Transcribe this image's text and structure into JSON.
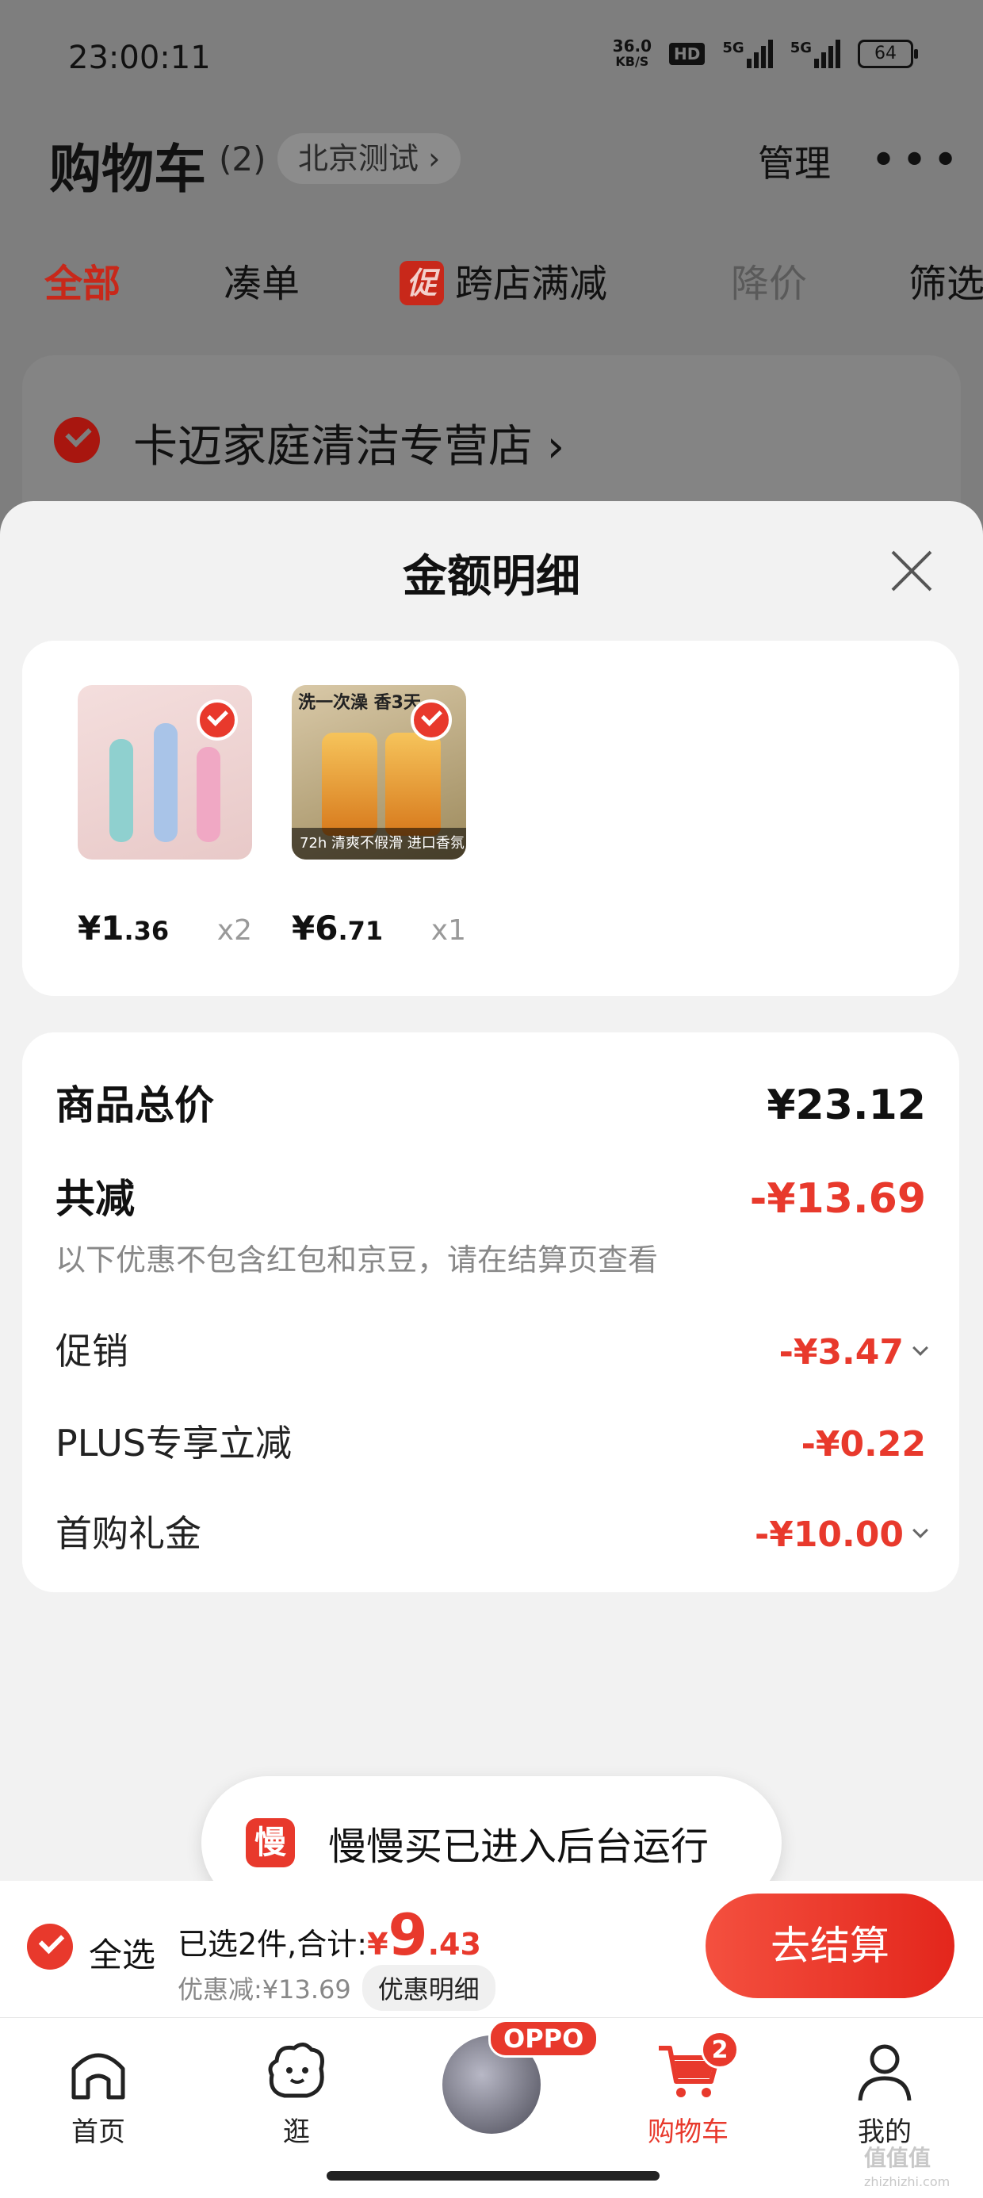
{
  "status_bar": {
    "time": "23:00:11",
    "net_speed_value": "36.0",
    "net_speed_unit": "KB/S",
    "hd_label": "HD",
    "sig1_label": "5G",
    "sig2_label": "5G",
    "battery": "64"
  },
  "header": {
    "title": "购物车",
    "count": "(2)",
    "location": "北京测试 ›",
    "manage": "管理",
    "more": "•••"
  },
  "filter_tabs": [
    {
      "label": "全部"
    },
    {
      "label": "凑单"
    },
    {
      "label": "跨店满减",
      "badge": "促"
    },
    {
      "label": "降价"
    },
    {
      "label": "筛选"
    }
  ],
  "store": {
    "name": "卡迈家庭清洁专营店 ›"
  },
  "sheet": {
    "title": "金额明细",
    "products": [
      {
        "price_int": "¥1",
        "price_dec": ".36",
        "qty": "x2"
      },
      {
        "price_int": "¥6",
        "price_dec": ".71",
        "qty": "x1",
        "img_top_text": "洗一次澡 香3天",
        "img_caption": "72h 清爽不假滑 进口香氛"
      }
    ],
    "summary": {
      "total_label": "商品总价",
      "total_value": "¥23.12",
      "discount_label": "共减",
      "discount_value": "-¥13.69",
      "note": "以下优惠不包含红包和京豆，请在结算页查看",
      "promo_label": "促销",
      "promo_value": "-¥3.47",
      "plus_label": "PLUS专享立减",
      "plus_value": "-¥0.22",
      "gift_label": "首购礼金",
      "gift_value": "-¥10.00"
    }
  },
  "toast": {
    "icon_text": "慢",
    "text": "慢慢买已进入后台运行"
  },
  "checkout": {
    "select_all": "全选",
    "selected_text": "已选2件,合计:",
    "total_sym": "¥",
    "total_int": "9",
    "total_dec": ".43",
    "discount_text": "优惠减:¥13.69",
    "detail_btn": "优惠明细",
    "checkout_btn": "去结算"
  },
  "bottom_nav": [
    {
      "label": "首页",
      "icon": "home-icon"
    },
    {
      "label": "逛",
      "icon": "explore-face-icon"
    },
    {
      "label": "",
      "icon": "oppo-phone-promo",
      "badge": "OPPO"
    },
    {
      "label": "购物车",
      "icon": "cart-icon",
      "badge": "2",
      "active": true
    },
    {
      "label": "我的",
      "icon": "profile-icon"
    }
  ],
  "watermark": {
    "main": "值值值",
    "sub": "zhizhizhi.com"
  },
  "colors": {
    "accent": "#e8392c",
    "overlay_bg": "#7e7e7e",
    "sheet_bg": "#f2f2f2"
  }
}
